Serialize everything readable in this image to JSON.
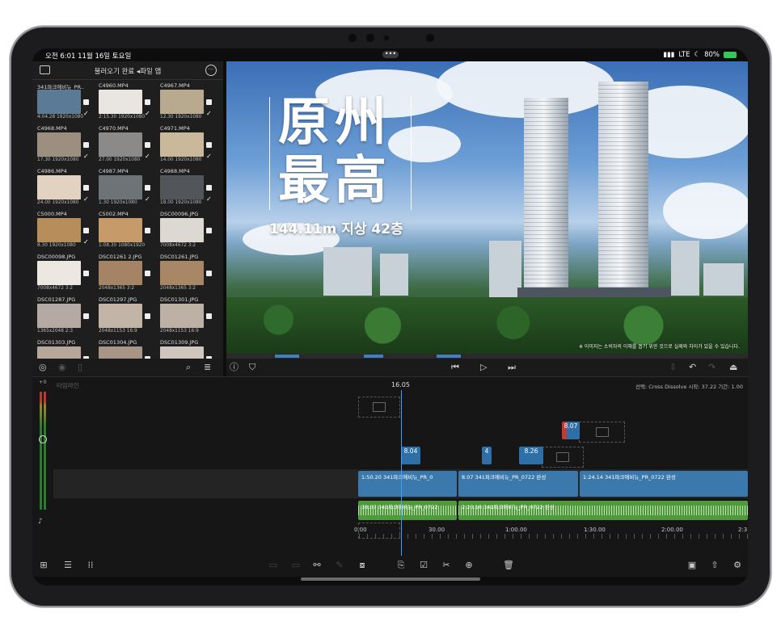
{
  "status": {
    "time": "오전 6:01  11월 16일 토요일",
    "network": "LTE",
    "battery": "80%",
    "center_dots": "•••"
  },
  "browser": {
    "title": "불러오기 완료 ◂파일 앱",
    "more": "···",
    "items": [
      {
        "name": "341파크애비뉴_PR..",
        "meta": "4:04.28  1920x1080",
        "color": "#5b7a96"
      },
      {
        "name": "C4960.MP4",
        "meta": "2:15.30  1920x1080",
        "color": "#e9e6e2"
      },
      {
        "name": "C4967.MP4",
        "meta": "12.30  1920x1080",
        "color": "#b9a98e"
      },
      {
        "name": "C4968.MP4",
        "meta": "17.30  1920x1080",
        "color": "#9c8f7f"
      },
      {
        "name": "C4970.MP4",
        "meta": "27.00  1920x1080",
        "color": "#8c8a88"
      },
      {
        "name": "C4971.MP4",
        "meta": "14.00  1920x1080",
        "color": "#c9b89a"
      },
      {
        "name": "C4986.MP4",
        "meta": "24.00  1920x1080",
        "color": "#e2d2c2"
      },
      {
        "name": "C4987.MP4",
        "meta": "1.30  1920x1080",
        "color": "#6e7377"
      },
      {
        "name": "C4988.MP4",
        "meta": "18.00  1920x1080",
        "color": "#52565a"
      },
      {
        "name": "C5000.MP4",
        "meta": "8.30  1920x1080",
        "color": "#b88d5c"
      },
      {
        "name": "C5002.MP4",
        "meta": "1:08.30  1080x1920",
        "color": "#c79a6a"
      },
      {
        "name": "DSC00096.JPG",
        "meta": "7008x4672  3:2",
        "color": "#dcd8d2"
      },
      {
        "name": "DSC00098.JPG",
        "meta": "7008x4672  3:2",
        "color": "#ece7e0"
      },
      {
        "name": "DSC01261 2.JPG",
        "meta": "2048x1365  3:2",
        "color": "#a58466"
      },
      {
        "name": "DSC01261.JPG",
        "meta": "2048x1365  3:2",
        "color": "#a88767"
      },
      {
        "name": "DSC01287.JPG",
        "meta": "1365x2048  2:3",
        "color": "#b4aaa3"
      },
      {
        "name": "DSC01297.JPG",
        "meta": "2048x1153  16:9",
        "color": "#c2b4a6"
      },
      {
        "name": "DSC01301.JPG",
        "meta": "2048x1153  16:9",
        "color": "#bdb1a6"
      },
      {
        "name": "DSC01303.JPG",
        "meta": "",
        "color": "#b7a79a"
      },
      {
        "name": "DSC01304.JPG",
        "meta": "",
        "color": "#a79586"
      },
      {
        "name": "DSC01309.JPG",
        "meta": "",
        "color": "#cfc6bd"
      }
    ]
  },
  "viewer": {
    "hero_line1": "原州",
    "hero_line2": "最高",
    "hero_sub": "144.11m 지상 42층",
    "disclaimer": "※ 이미지는 소비자의 이해를 돕기 위한 것으로 실제와 차이가 있을 수 있습니다."
  },
  "timeline": {
    "label": "타임라인",
    "timecode": "16.05",
    "selection_info": "선택: Cross Dissolve 시작: 37.22 기간: 1.00",
    "meter_top": "+0",
    "title_clips": [
      "8.04",
      "4",
      "8.26",
      "8.07"
    ],
    "video_clips": [
      "1:50.20  341파크애비뉴_PR_0",
      "8.07  341파크애비뉴_PR_0722 완성",
      "1:24.14  341파크애비뉴_PR_0722 완성"
    ],
    "audio_clips": [
      "38.07  341파크애비뉴_PR_0722",
      "2:20.16  341파크애비뉴_PR_0722 완성"
    ],
    "ruler": [
      "0.00",
      "30.00",
      "1:00.00",
      "1:30.00",
      "2:00.00",
      "2:3"
    ]
  },
  "icons": {
    "select": "check-circle-icon",
    "record": "record-icon",
    "trash": "trash-icon",
    "search": "search-icon",
    "sort": "sort-icon",
    "info": "info-icon",
    "marker": "marker-icon",
    "skip_back": "skip-back-icon",
    "play": "play-icon",
    "skip_forward": "skip-forward-icon",
    "undo": "undo-icon",
    "redo": "redo-icon",
    "airplay": "airplay-icon"
  }
}
